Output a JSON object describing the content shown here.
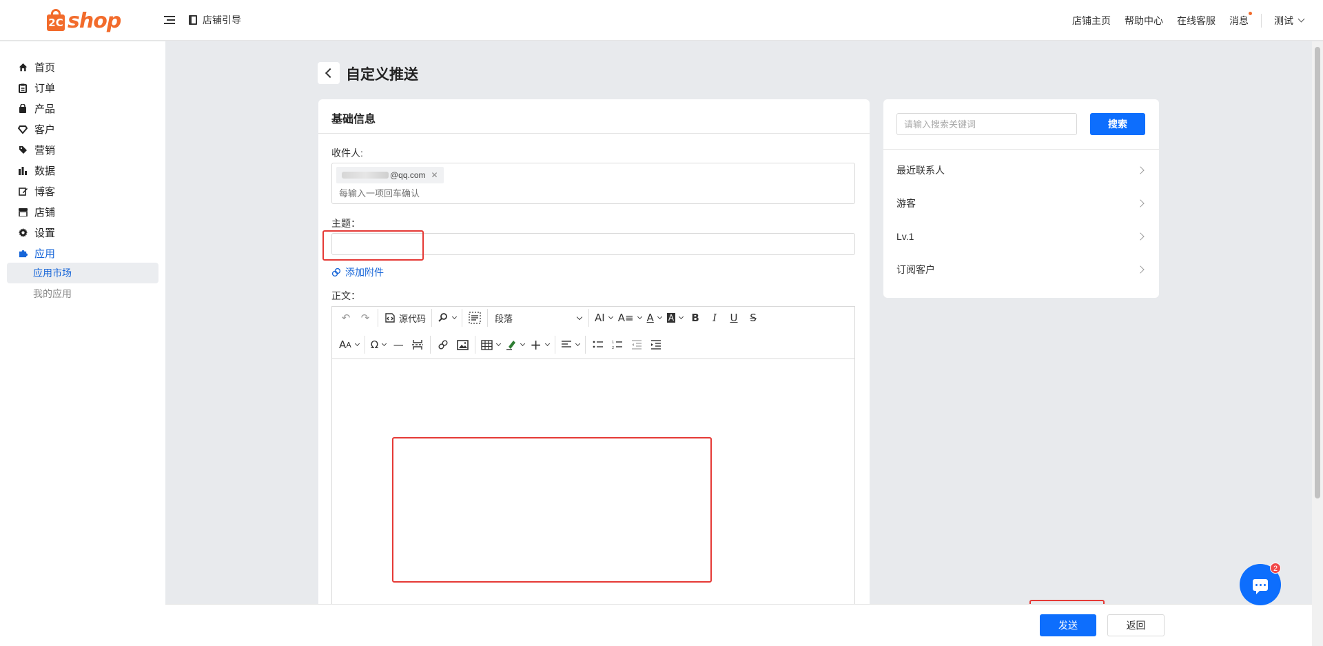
{
  "brand": {
    "mark": "2C",
    "name": "shop"
  },
  "header": {
    "guide_label": "店铺引导",
    "nav": [
      "店铺主页",
      "帮助中心",
      "在线客服",
      "消息"
    ],
    "user": "测试"
  },
  "sidebar": {
    "items": [
      {
        "label": "首页",
        "icon": "home-icon"
      },
      {
        "label": "订单",
        "icon": "clipboard-icon"
      },
      {
        "label": "产品",
        "icon": "bag-icon"
      },
      {
        "label": "客户",
        "icon": "diamond-icon"
      },
      {
        "label": "营销",
        "icon": "tag-icon"
      },
      {
        "label": "数据",
        "icon": "bar-chart-icon"
      },
      {
        "label": "博客",
        "icon": "edit-icon"
      },
      {
        "label": "店铺",
        "icon": "store-icon"
      },
      {
        "label": "设置",
        "icon": "gear-icon"
      },
      {
        "label": "应用",
        "icon": "puzzle-icon"
      }
    ],
    "sub_items": [
      "应用市场",
      "我的应用"
    ]
  },
  "page": {
    "title": "自定义推送"
  },
  "form": {
    "section_title": "基础信息",
    "recipient_label": "收件人:",
    "recipient_tag": "@qq.com",
    "recipient_placeholder": "每输入一项回车确认",
    "subject_label": "主题：",
    "subject_value": "",
    "attach_label": "添加附件",
    "body_label": "正文："
  },
  "editor": {
    "source_label": "源代码",
    "paragraph_select": "段落"
  },
  "side": {
    "search_placeholder": "请输入搜索关键词",
    "search_button": "搜索",
    "groups": [
      "最近联系人",
      "游客",
      "Lv.1",
      "订阅客户"
    ]
  },
  "footer": {
    "send": "发送",
    "back": "返回"
  },
  "chat": {
    "badge": "2"
  },
  "colors": {
    "brand": "#f26b2b",
    "primary": "#0d6efd",
    "link": "#1665d8",
    "annotation": "#e53935"
  }
}
